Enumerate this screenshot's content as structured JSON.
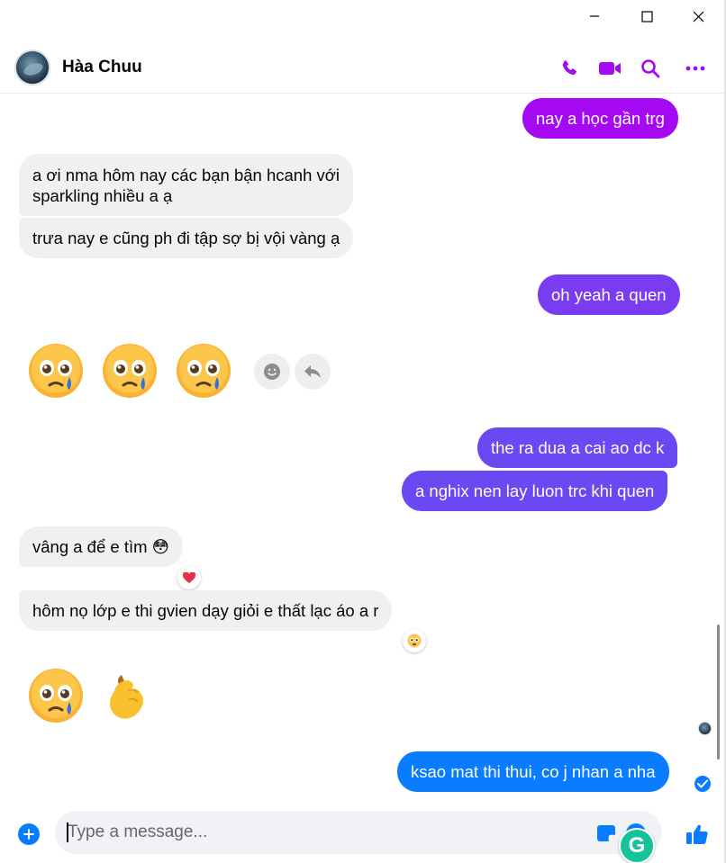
{
  "window": {
    "controls": [
      "minimize-icon",
      "maximize-icon",
      "close-icon"
    ]
  },
  "header": {
    "contact_name": "Hà̀a Chuu",
    "actions": [
      "phone-icon",
      "video-camera-icon",
      "search-icon",
      "more-icon"
    ]
  },
  "colors": {
    "accent": "#a409f2",
    "blue": "#0a7cff",
    "incoming_bubble": "#f0f0f0"
  },
  "messages": [
    {
      "from": "me",
      "text": "nay a học gần trg"
    },
    {
      "from": "them",
      "text": "a ơi nma hôm nay các bạn bận hcanh với\nsparkling nhiều a ạ"
    },
    {
      "from": "them",
      "text": "trưa nay e cũng ph đi tập sợ bị vội vàng ạ"
    },
    {
      "from": "me",
      "text": "oh yeah a quen"
    },
    {
      "from": "them",
      "emoji": [
        "pleading-face-tear-icon",
        "pleading-face-tear-icon",
        "pleading-face-tear-icon"
      ]
    },
    {
      "from": "me",
      "text": "the ra dua a cai ao dc k"
    },
    {
      "from": "me",
      "text": "a nghix nen lay luon trc khi quen"
    },
    {
      "from": "them",
      "text": "vâng a để e tìm 😳",
      "reaction": "heart-icon"
    },
    {
      "from": "them",
      "text": "hôm nọ lớp e thi gvien dạy giỏi e thất lạc áo a r",
      "reaction": "flushed-face-icon"
    },
    {
      "from": "them",
      "emoji": [
        "pleading-face-tear-icon",
        "finger-heart-icon"
      ]
    },
    {
      "from": "me",
      "text": "ksao mat thi thui, co j nhan a nha"
    }
  ],
  "composer": {
    "placeholder": "Type a message..."
  }
}
